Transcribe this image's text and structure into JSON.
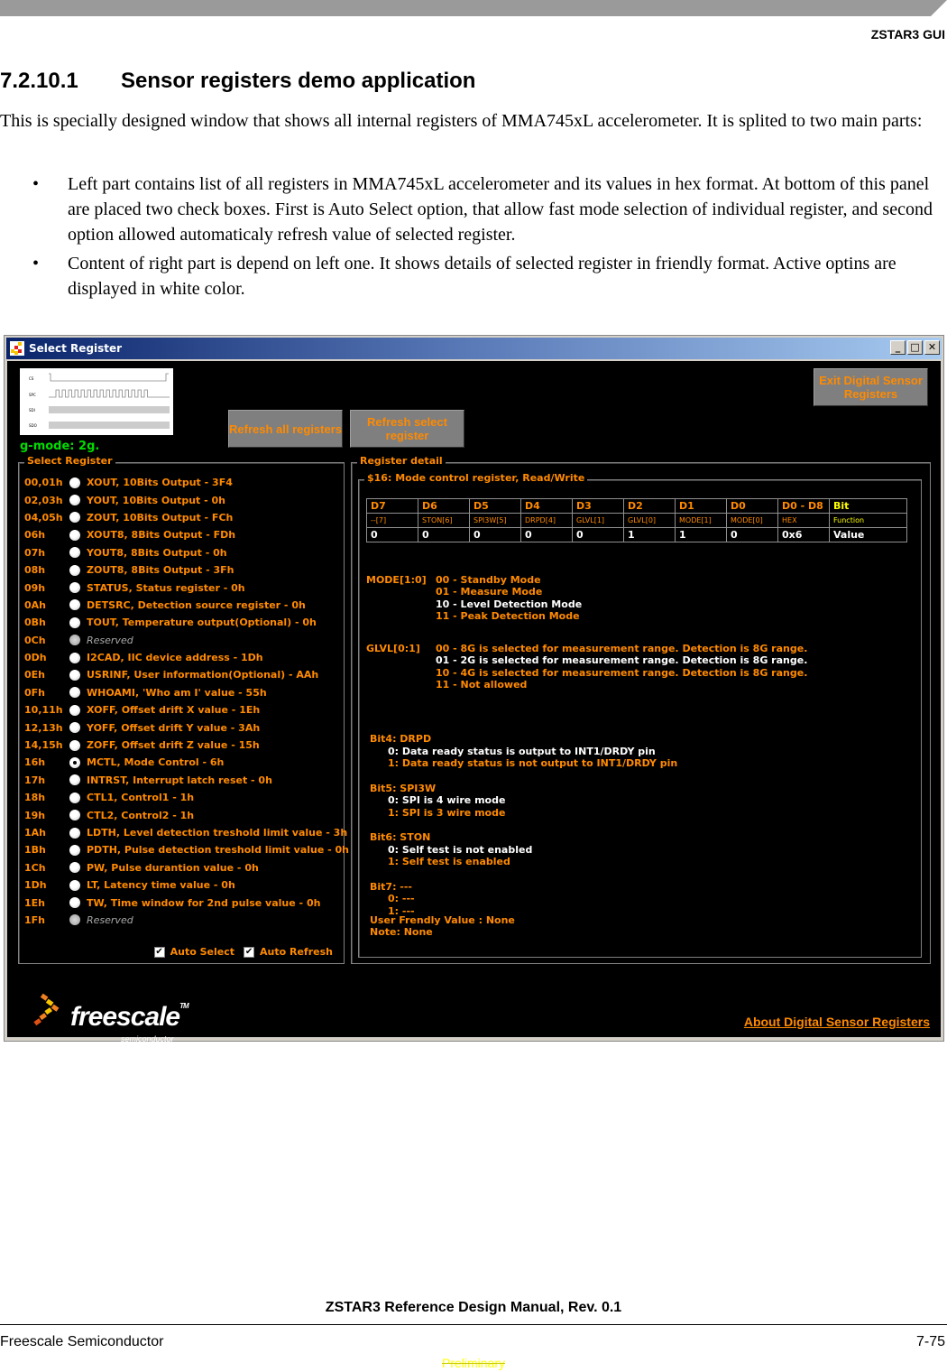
{
  "page_header": {
    "section_tag": "ZSTAR3 GUI"
  },
  "section": {
    "number": "7.2.10.1",
    "title": "Sensor registers demo application"
  },
  "intro": "This is specially designed window that shows all internal registers of MMA745xL accelerometer. It is splited to two main parts:",
  "bullets": [
    "Left part contains list of all registers in MMA745xL accelerometer and its values in hex format. At bottom of this panel are placed two check boxes. First is Auto Select option, that allow fast mode selection of individual register, and second option allowed automaticaly refresh value of selected register.",
    "Content of right part is depend on left one. It shows details of selected register in friendly format. Active optins are displayed in white color."
  ],
  "window": {
    "title": "Select Register",
    "icon": "app-icon",
    "controls": {
      "minimize": "_",
      "maximize": "□",
      "close": "✕"
    },
    "timing_labels": [
      "CS",
      "SPC",
      "SDI",
      "SDO"
    ],
    "g_mode": "g-mode:  2g.",
    "buttons": {
      "refresh_all": "Refresh all registers",
      "refresh_select": "Refresh select register",
      "exit": "Exit Digital Sensor Registers"
    },
    "select_panel": {
      "title": "Select Register",
      "registers": [
        {
          "addr": "00,01h",
          "name": "XOUT, 10Bits Output - 3F4"
        },
        {
          "addr": "02,03h",
          "name": "YOUT, 10Bits Output - 0h"
        },
        {
          "addr": "04,05h",
          "name": "ZOUT, 10Bits Output - FCh"
        },
        {
          "addr": "06h",
          "name": "XOUT8, 8Bits Output - FDh"
        },
        {
          "addr": "07h",
          "name": "YOUT8, 8Bits Output - 0h"
        },
        {
          "addr": "08h",
          "name": "ZOUT8, 8Bits Output - 3Fh"
        },
        {
          "addr": "09h",
          "name": "STATUS, Status register - 0h"
        },
        {
          "addr": "0Ah",
          "name": "DETSRC, Detection source register - 0h"
        },
        {
          "addr": "0Bh",
          "name": "TOUT, Temperature output(Optional) - 0h"
        },
        {
          "addr": "0Ch",
          "name": "Reserved",
          "reserved": true
        },
        {
          "addr": "0Dh",
          "name": "I2CAD, IIC device address - 1Dh"
        },
        {
          "addr": "0Eh",
          "name": "USRINF, User information(Optional) - AAh"
        },
        {
          "addr": "0Fh",
          "name": "WHOAMI, 'Who am I' value - 55h"
        },
        {
          "addr": "10,11h",
          "name": "XOFF, Offset drift X value - 1Eh"
        },
        {
          "addr": "12,13h",
          "name": "YOFF, Offset drift Y value - 3Ah"
        },
        {
          "addr": "14,15h",
          "name": "ZOFF, Offset drift Z value - 15h"
        },
        {
          "addr": "16h",
          "name": "MCTL, Mode Control - 6h",
          "selected": true
        },
        {
          "addr": "17h",
          "name": "INTRST, Interrupt latch reset - 0h"
        },
        {
          "addr": "18h",
          "name": "CTL1, Control1 - 1h"
        },
        {
          "addr": "19h",
          "name": "CTL2, Control2 - 1h"
        },
        {
          "addr": "1Ah",
          "name": "LDTH, Level detection treshold limit value - 3h"
        },
        {
          "addr": "1Bh",
          "name": "PDTH, Pulse detection treshold limit value - 0h"
        },
        {
          "addr": "1Ch",
          "name": "PW, Pulse durantion value - 0h"
        },
        {
          "addr": "1Dh",
          "name": "LT, Latency time value - 0h"
        },
        {
          "addr": "1Eh",
          "name": "TW, Time window for 2nd pulse value - 0h"
        },
        {
          "addr": "1Fh",
          "name": "Reserved",
          "reserved": true
        }
      ],
      "auto_select": {
        "label": "Auto Select",
        "checked": true
      },
      "auto_refresh": {
        "label": "Auto Refresh",
        "checked": true
      }
    },
    "detail_panel": {
      "title": "Register detail",
      "subtitle": "$16: Mode control register, Read/Write",
      "bit_row": [
        "D7",
        "D6",
        "D5",
        "D4",
        "D3",
        "D2",
        "D1",
        "D0",
        "D0 - D8",
        "Bit"
      ],
      "function_row": [
        "--[7]",
        "STON[6]",
        "SPI3W[5]",
        "DRPD[4]",
        "GLVL[1]",
        "GLVL[0]",
        "MODE[1]",
        "MODE[0]",
        "HEX",
        "Function"
      ],
      "value_row": [
        "0",
        "0",
        "0",
        "0",
        "0",
        "1",
        "1",
        "0",
        "0x6",
        "Value"
      ],
      "mode": {
        "label": "MODE[1:0]",
        "options": [
          {
            "text": "00 - Standby Mode",
            "active": false
          },
          {
            "text": "01 - Measure Mode",
            "active": false
          },
          {
            "text": "10 - Level Detection Mode",
            "active": true
          },
          {
            "text": "11 - Peak Detection Mode",
            "active": false
          }
        ]
      },
      "glvl": {
        "label": "GLVL[0:1]",
        "options": [
          {
            "text": "00 - 8G is selected for measurement range. Detection is 8G range.",
            "active": false
          },
          {
            "text": "01 - 2G is selected for measurement range. Detection is 8G range.",
            "active": true
          },
          {
            "text": "10 - 4G is selected for measurement range. Detection is 8G range.",
            "active": false
          },
          {
            "text": "11 - Not allowed",
            "active": false
          }
        ]
      },
      "bits": [
        {
          "label": "Bit4: DRPD",
          "opt0": "0: Data ready status is output to INT1/DRDY pin",
          "opt1": "1: Data ready status is not output to INT1/DRDY pin",
          "active": 0
        },
        {
          "label": "Bit5: SPI3W",
          "opt0": "0: SPI is 4 wire mode",
          "opt1": "1: SPI is 3 wire mode",
          "active": 0
        },
        {
          "label": "Bit6: STON",
          "opt0": "0: Self test is not enabled",
          "opt1": "1: Self test is enabled",
          "active": 0
        },
        {
          "label": "Bit7: ---",
          "opt0": "0: ---",
          "opt1": "1: ---",
          "active": -1
        }
      ],
      "user_friendly": "User Frendly Value :   None",
      "note": "Note:  None"
    },
    "logo": {
      "word": "freescale",
      "tm": "TM",
      "sub": "semiconductor"
    },
    "about_link": "About Digital Sensor Registers"
  },
  "footer": {
    "title": "ZSTAR3 Reference Design Manual, Rev. 0.1",
    "left": "Freescale Semiconductor",
    "right": "7-75",
    "watermark": "Preliminary"
  }
}
